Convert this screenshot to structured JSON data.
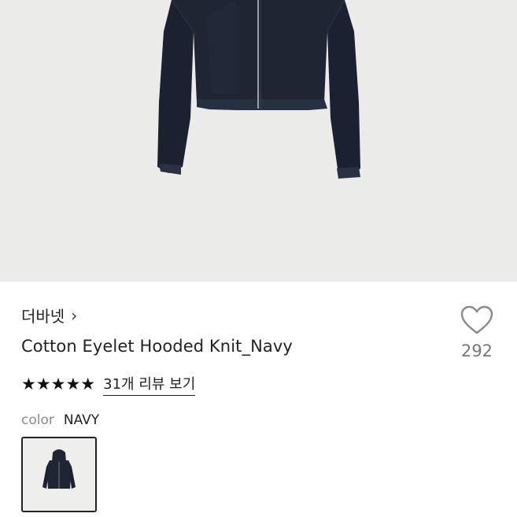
{
  "product": {
    "brand": "더바넷",
    "brand_chevron": "›",
    "title": "Cotton Eyelet Hooded Knit_Navy",
    "rating_stars": "★★★★★",
    "review_link": "31개 리뷰 보기",
    "color_label": "color",
    "color_value": "NAVY",
    "like_count": "292"
  },
  "icons": {
    "heart": "heart-outline-icon",
    "chevron": "chevron-right-icon",
    "star": "star-filled-icon"
  },
  "colors": {
    "garment": "#1f2533",
    "hero_bg": "#ebebe9",
    "heart_stroke": "#8a8a8a"
  }
}
